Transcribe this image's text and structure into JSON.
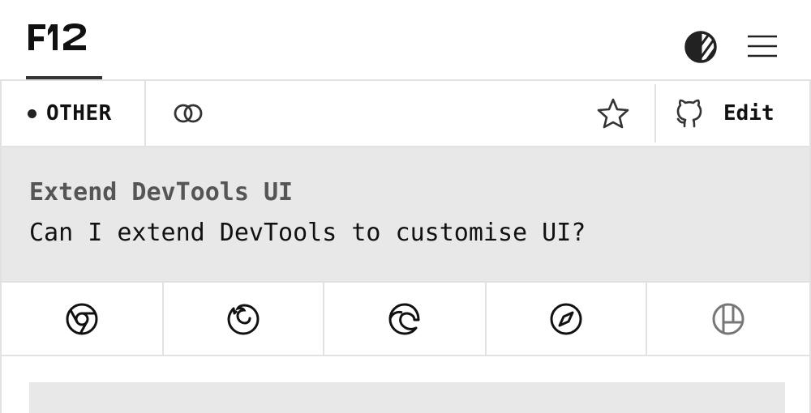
{
  "header": {
    "logo_text": "F12",
    "theme_toggle_icon": "contrast-icon",
    "menu_icon": "hamburger-menu-icon"
  },
  "toolbar": {
    "category_label": "OTHER",
    "link_icon": "link-icon",
    "favorite_icon": "star-icon",
    "edit_label": "Edit",
    "edit_icon": "github-icon"
  },
  "question": {
    "title": "Extend DevTools UI",
    "text": "Can I extend DevTools to customise UI?"
  },
  "browsers": [
    {
      "name": "chrome-icon"
    },
    {
      "name": "firefox-icon"
    },
    {
      "name": "edge-icon"
    },
    {
      "name": "safari-icon"
    },
    {
      "name": "polypane-icon"
    }
  ],
  "colors": {
    "background": "#ffffff",
    "panel": "#e8e8e8",
    "border": "#e2e2e2",
    "text": "#111111",
    "muted_text": "#555555",
    "muted_icon": "#777777"
  }
}
